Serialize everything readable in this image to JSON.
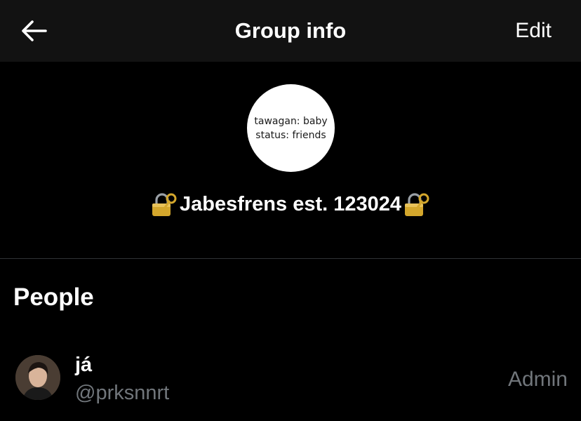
{
  "header": {
    "back_icon": "arrow-left-icon",
    "title": "Group info",
    "edit_label": "Edit"
  },
  "group": {
    "avatar_line1": "tawagan: baby",
    "avatar_line2": "status: friends",
    "name": "Jabesfrens est. 123024",
    "name_icon": "locked-with-key-icon"
  },
  "people": {
    "heading": "People",
    "members": [
      {
        "name": "já",
        "handle": "@prksnnrt",
        "role": "Admin",
        "avatar_icon": "user-avatar"
      }
    ]
  },
  "colors": {
    "background": "#000000",
    "header_background": "#121212",
    "text_primary": "#ffffff",
    "text_secondary": "#71767b",
    "divider": "#2f3336"
  }
}
